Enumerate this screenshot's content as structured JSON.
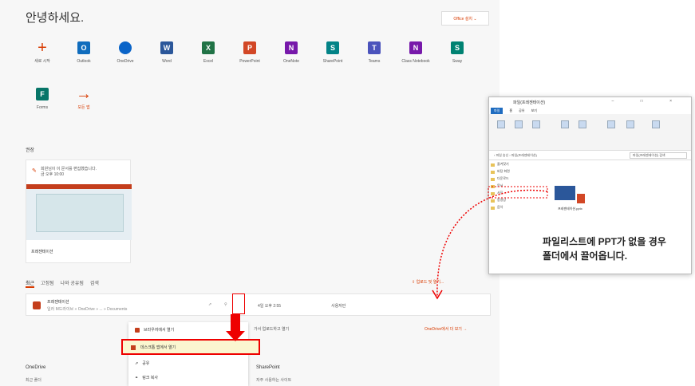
{
  "greeting": "안녕하세요.",
  "install_button": "Office 설치 ⌄",
  "apps": [
    {
      "label": "새로 시작",
      "color": "#d83b01",
      "icon": "plus-icon"
    },
    {
      "label": "Outlook",
      "color": "#0f6cbd",
      "icon": "outlook-icon"
    },
    {
      "label": "OneDrive",
      "color": "#0a64c8",
      "icon": "onedrive-icon"
    },
    {
      "label": "Word",
      "color": "#2b579a",
      "icon": "word-icon"
    },
    {
      "label": "Excel",
      "color": "#217346",
      "icon": "excel-icon"
    },
    {
      "label": "PowerPoint",
      "color": "#d24726",
      "icon": "powerpoint-icon"
    },
    {
      "label": "OneNote",
      "color": "#7719aa",
      "icon": "onenote-icon"
    },
    {
      "label": "SharePoint",
      "color": "#038387",
      "icon": "sharepoint-icon"
    },
    {
      "label": "Teams",
      "color": "#4b53bc",
      "icon": "teams-icon"
    },
    {
      "label": "Class Notebook",
      "color": "#7719aa",
      "icon": "class-notebook-icon"
    },
    {
      "label": "Sway",
      "color": "#008272",
      "icon": "sway-icon"
    },
    {
      "label": "Forms",
      "color": "#077568",
      "icon": "forms-icon"
    },
    {
      "label": "모든 앱",
      "color": "#d83b01",
      "icon": "arrow-right-icon"
    }
  ],
  "recommended": {
    "heading": "권장",
    "card_text": "회원님이 이 문서를 편집했습니다.",
    "card_sub": "금 오후 10:00",
    "caption": "프레젠테이션"
  },
  "tabs": [
    "최근",
    "고정됨",
    "나와 공유됨",
    "검색"
  ],
  "upload": "⇪ 업로드 및 열기...",
  "file_row": {
    "name": "프레젠테이션",
    "location": "일러 M드라이브 » OneDrive » ... » Documents",
    "modified": "4일 오후 2:55",
    "activity": "사용자만"
  },
  "context_menu": {
    "items": [
      "브라우저에서 열기",
      "데스크톱 앱에서 열기",
      "공유",
      "링크 복사"
    ]
  },
  "shared_text": "가서 업로드하고 열기",
  "onedrive_link": "OneDrive에서 더 보기 →",
  "onedrive": {
    "heading": "OneDrive",
    "sub": "최근 폴더"
  },
  "sharepoint": {
    "heading": "SharePoint",
    "sub": "자주 사용하는 사이트"
  },
  "explorer": {
    "title": "파일(프레젠테이션)",
    "tabs": [
      "파일",
      "홈",
      "공유",
      "보기"
    ],
    "address": "› 파일 송신 › 파일(프레젠테이션)",
    "search": "파일(프레젠테이션) 검색",
    "nav": [
      "즐겨찾기",
      "바탕 화면",
      "다운로드",
      "문서",
      "사진",
      "동영상",
      "음악"
    ],
    "file": "프레젠테이션.pptx"
  },
  "note_line1": "파일리스트에 PPT가 없을 경우",
  "note_line2": "폴더에서 끌어옵니다."
}
